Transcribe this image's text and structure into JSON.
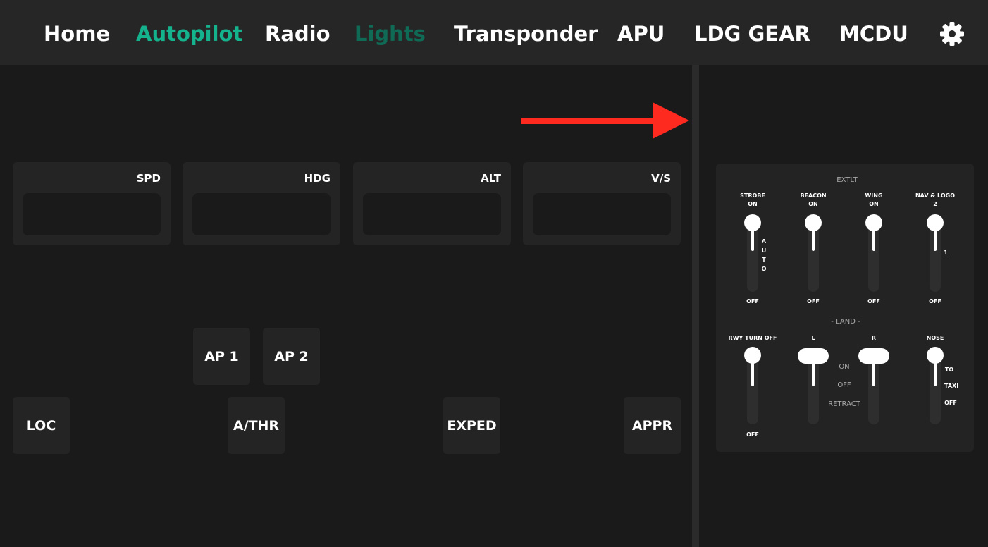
{
  "nav": {
    "home": "Home",
    "autopilot": "Autopilot",
    "radio": "Radio",
    "lights": "Lights",
    "transponder": "Transponder",
    "apu": "APU",
    "ldg_gear": "LDG GEAR",
    "mcdu": "MCDU",
    "settings_icon": "gear-icon"
  },
  "autopilot": {
    "spd": "SPD",
    "hdg": "HDG",
    "alt": "ALT",
    "vs": "V/S",
    "ap1": "AP 1",
    "ap2": "AP 2",
    "loc": "LOC",
    "athr": "A/THR",
    "exped": "EXPED",
    "appr": "APPR"
  },
  "lights": {
    "extlt": "EXTLT",
    "strobe": {
      "label": "STROBE",
      "top": "ON",
      "mid": "A U T O",
      "bottom": "OFF"
    },
    "beacon": {
      "label": "BEACON",
      "top": "ON",
      "bottom": "OFF"
    },
    "wing": {
      "label": "WING",
      "top": "ON",
      "bottom": "OFF"
    },
    "navlogo": {
      "label": "NAV & LOGO",
      "top": "2",
      "mid": "1",
      "bottom": "OFF"
    },
    "land": "- LAND -",
    "rwy": {
      "label": "RWY TURN OFF",
      "bottom": "OFF"
    },
    "land_l": "L",
    "land_r": "R",
    "land_on": "ON",
    "land_off": "OFF",
    "land_retract": "RETRACT",
    "nose": {
      "label": "NOSE",
      "to": "TO",
      "taxi": "TAXI",
      "off": "OFF"
    }
  },
  "colors": {
    "accent": "#14b38d",
    "accent_dim": "#0f6b56",
    "arrow": "#ff2a1f"
  }
}
